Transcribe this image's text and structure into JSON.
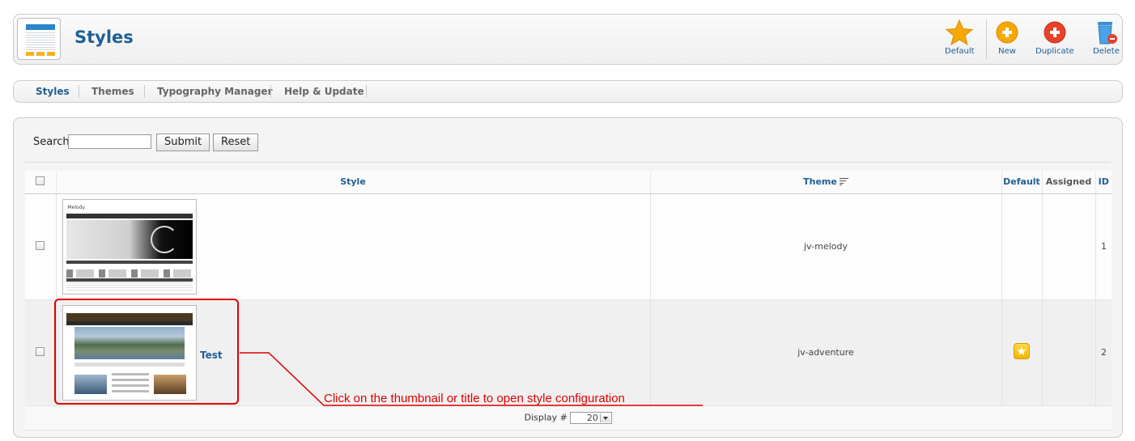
{
  "header": {
    "title": "Styles",
    "toolbar": {
      "default_label": "Default",
      "new_label": "New",
      "duplicate_label": "Duplicate",
      "delete_label": "Delete"
    }
  },
  "tabs": [
    {
      "label": "Styles",
      "active": true
    },
    {
      "label": "Themes",
      "active": false
    },
    {
      "label": "Typography Manager",
      "active": false
    },
    {
      "label": "Help & Update",
      "active": false
    }
  ],
  "search": {
    "label": "Search",
    "value": "",
    "submit_label": "Submit",
    "reset_label": "Reset"
  },
  "table": {
    "columns": {
      "style": "Style",
      "theme": "Theme",
      "default": "Default",
      "assigned": "Assigned",
      "id": "ID"
    },
    "rows": [
      {
        "thumbnail_title": "Melody",
        "title": "",
        "theme": "jv-melody",
        "is_default": false,
        "assigned": "",
        "id": "1"
      },
      {
        "thumbnail_title": "",
        "title": "Test",
        "theme": "jv-adventure",
        "is_default": true,
        "assigned": "",
        "id": "2"
      }
    ]
  },
  "pagination": {
    "display_label": "Display #",
    "display_value": "20"
  },
  "annotation": {
    "text": "Click on the thumbnail or title to open style configuration",
    "color": "#e00000"
  },
  "colors": {
    "accent_blue": "#1e5f95",
    "star_orange": "#f6a800",
    "delete_red": "#e8412a"
  }
}
